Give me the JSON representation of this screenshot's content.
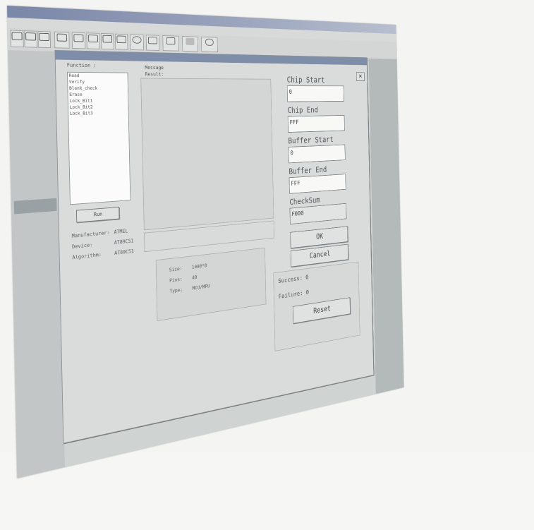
{
  "window": {
    "title": "",
    "menu": [
      "",
      "",
      "",
      "",
      "",
      ""
    ],
    "toolbar": [
      {
        "icon": "open-icon",
        "label": ""
      },
      {
        "icon": "save-icon",
        "label": ""
      },
      {
        "icon": "edit-icon",
        "label": ""
      },
      {
        "icon": "device-icon",
        "label": ""
      },
      {
        "icon": "run-icon",
        "label": ""
      },
      {
        "icon": "prog-icon",
        "label": ""
      },
      {
        "icon": "read-icon",
        "label": ""
      },
      {
        "icon": "verify-icon",
        "label": ""
      },
      {
        "icon": "light-icon",
        "label": ""
      },
      {
        "icon": "split-icon",
        "label": ""
      },
      {
        "icon": "frame-icon",
        "label": ""
      },
      {
        "icon": "blank-icon",
        "label": ""
      },
      {
        "icon": "chip-icon",
        "label": ""
      }
    ]
  },
  "dialog": {
    "title": "",
    "close_icon": "close-icon",
    "function_label": "Function :",
    "functions": [
      "",
      "",
      "Read",
      "Verify",
      "Blank_check",
      "Erase",
      "Lock_Bit1",
      "Lock_Bit2",
      "Lock_Bit3"
    ],
    "selected_index": 1,
    "run_label": "Run",
    "message_label": "Message",
    "result_label": "Result:",
    "manufacturer_label": "Manufacturer:",
    "manufacturer_value": "ATMEL",
    "device_label": "Device:",
    "device_value": "AT89C51",
    "algorithm_label": "Algorithm:",
    "algorithm_value": "AT89C51",
    "size_label": "Size:",
    "size_value": "1000*8",
    "pins_label": "Pins:",
    "pins_value": "40",
    "type_label": "Type:",
    "type_value": "MCU/MPU",
    "chip_start_label": "Chip Start",
    "chip_start_value": "0",
    "chip_end_label": "Chip End",
    "chip_end_value": "FFF",
    "buffer_start_label": "Buffer Start",
    "buffer_start_value": "0",
    "buffer_end_label": "Buffer End",
    "buffer_end_value": "FFF",
    "checksum_label": "CheckSum",
    "checksum_value": "F000",
    "ok_label": "OK",
    "cancel_label": "Cancel",
    "success_label": "Success: 0",
    "failure_label": "Failure: 0",
    "reset_label": "Reset"
  }
}
